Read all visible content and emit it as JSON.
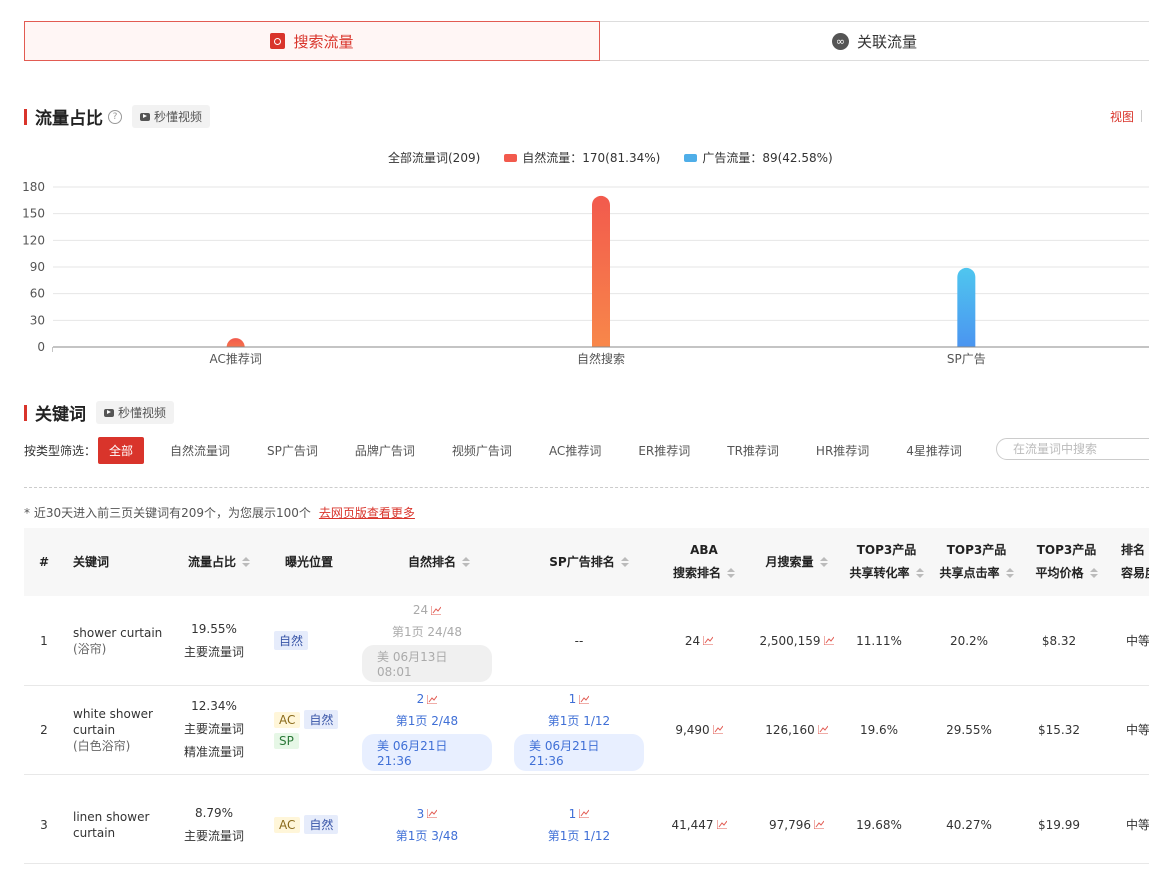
{
  "tabs": [
    {
      "label": "搜索流量",
      "icon": "search-doc-icon",
      "active": true
    },
    {
      "label": "关联流量",
      "icon": "link-icon",
      "active": false
    }
  ],
  "traffic_section": {
    "title": "流量占比",
    "help": "?",
    "video_label": "秒懂视频",
    "view_label": "视图"
  },
  "legend": {
    "all": "全部流量词(209)",
    "natural": "自然流量：170(81.34%)",
    "ad": "广告流量：89(42.58%)"
  },
  "colors": {
    "accent": "#d9342b",
    "natural": "#f25a4d",
    "ad": "#4faee8",
    "link_blue": "#3f6fd6"
  },
  "chart_data": {
    "type": "bar",
    "categories": [
      "AC推荐词",
      "自然搜索",
      "SP广告"
    ],
    "series": [
      {
        "name": "自然流量",
        "values": [
          10,
          170,
          0
        ]
      },
      {
        "name": "广告流量",
        "values": [
          0,
          0,
          89
        ]
      }
    ],
    "ylim": [
      0,
      180
    ],
    "yticks": [
      0,
      30,
      60,
      90,
      120,
      150,
      180
    ],
    "grid": true
  },
  "keyword_section": {
    "title": "关键词",
    "video_label": "秒懂视频"
  },
  "filter": {
    "label": "按类型筛选：",
    "chips": [
      "全部",
      "自然流量词",
      "SP广告词",
      "品牌广告词",
      "视频广告词",
      "AC推荐词",
      "ER推荐词",
      "TR推荐词",
      "HR推荐词",
      "4星推荐词"
    ],
    "search_placeholder": "在流量词中搜索"
  },
  "note": {
    "text": "* 近30天进入前三页关键词有209个，为您展示100个",
    "link": "去网页版查看更多"
  },
  "table": {
    "headers": {
      "idx": "#",
      "keyword": "关键词",
      "share": "流量占比",
      "exposure": "曝光位置",
      "natural_rank": "自然排名",
      "sp_rank": "SP广告排名",
      "aba_1": "ABA",
      "aba_2": "搜索排名",
      "monthly": "月搜索量",
      "conv_1": "TOP3产品",
      "conv_2": "共享转化率",
      "ctr_1": "TOP3产品",
      "ctr_2": "共享点击率",
      "price_1": "TOP3产品",
      "price_2": "平均价格",
      "diff_1": "排名",
      "diff_2": "容易度"
    },
    "rows": [
      {
        "idx": "1",
        "kw_en_1": "shower curtain",
        "kw_en_2": "",
        "kw_cn": "(浴帘)",
        "share_pct": "19.55%",
        "share_t1": "主要流量词",
        "share_t2": "",
        "nat_rank": "24",
        "nat_page": "第1页 24/48",
        "nat_time": "美 06月13日 08:01",
        "sp_rank": "--",
        "aba": "24",
        "monthly": "2,500,159",
        "conv": "11.11%",
        "ctr": "20.2%",
        "price": "$8.32",
        "diff": "中等"
      },
      {
        "idx": "2",
        "kw_en_1": "white shower",
        "kw_en_2": "curtain",
        "kw_cn": "(白色浴帘)",
        "share_pct": "12.34%",
        "share_t1": "主要流量词",
        "share_t2": "精准流量词",
        "nat_rank": "2",
        "nat_page": "第1页 2/48",
        "nat_time": "美 06月21日 21:36",
        "sp_rank": "1",
        "sp_page": "第1页 1/12",
        "sp_time": "美 06月21日 21:36",
        "aba": "9,490",
        "monthly": "126,160",
        "conv": "19.6%",
        "ctr": "29.55%",
        "price": "$15.32",
        "diff": "中等"
      },
      {
        "idx": "3",
        "kw_en_1": "linen shower",
        "kw_en_2": "curtain",
        "share_pct": "8.79%",
        "share_t1": "主要流量词",
        "nat_rank": "3",
        "nat_page": "第1页 3/48",
        "sp_rank": "1",
        "sp_page": "第1页 1/12",
        "aba": "41,447",
        "monthly": "97,796",
        "conv": "19.68%",
        "ctr": "40.27%",
        "price": "$19.99",
        "diff": "中等"
      }
    ],
    "tags": {
      "natural": "自然",
      "ac": "AC",
      "sp": "SP"
    }
  }
}
